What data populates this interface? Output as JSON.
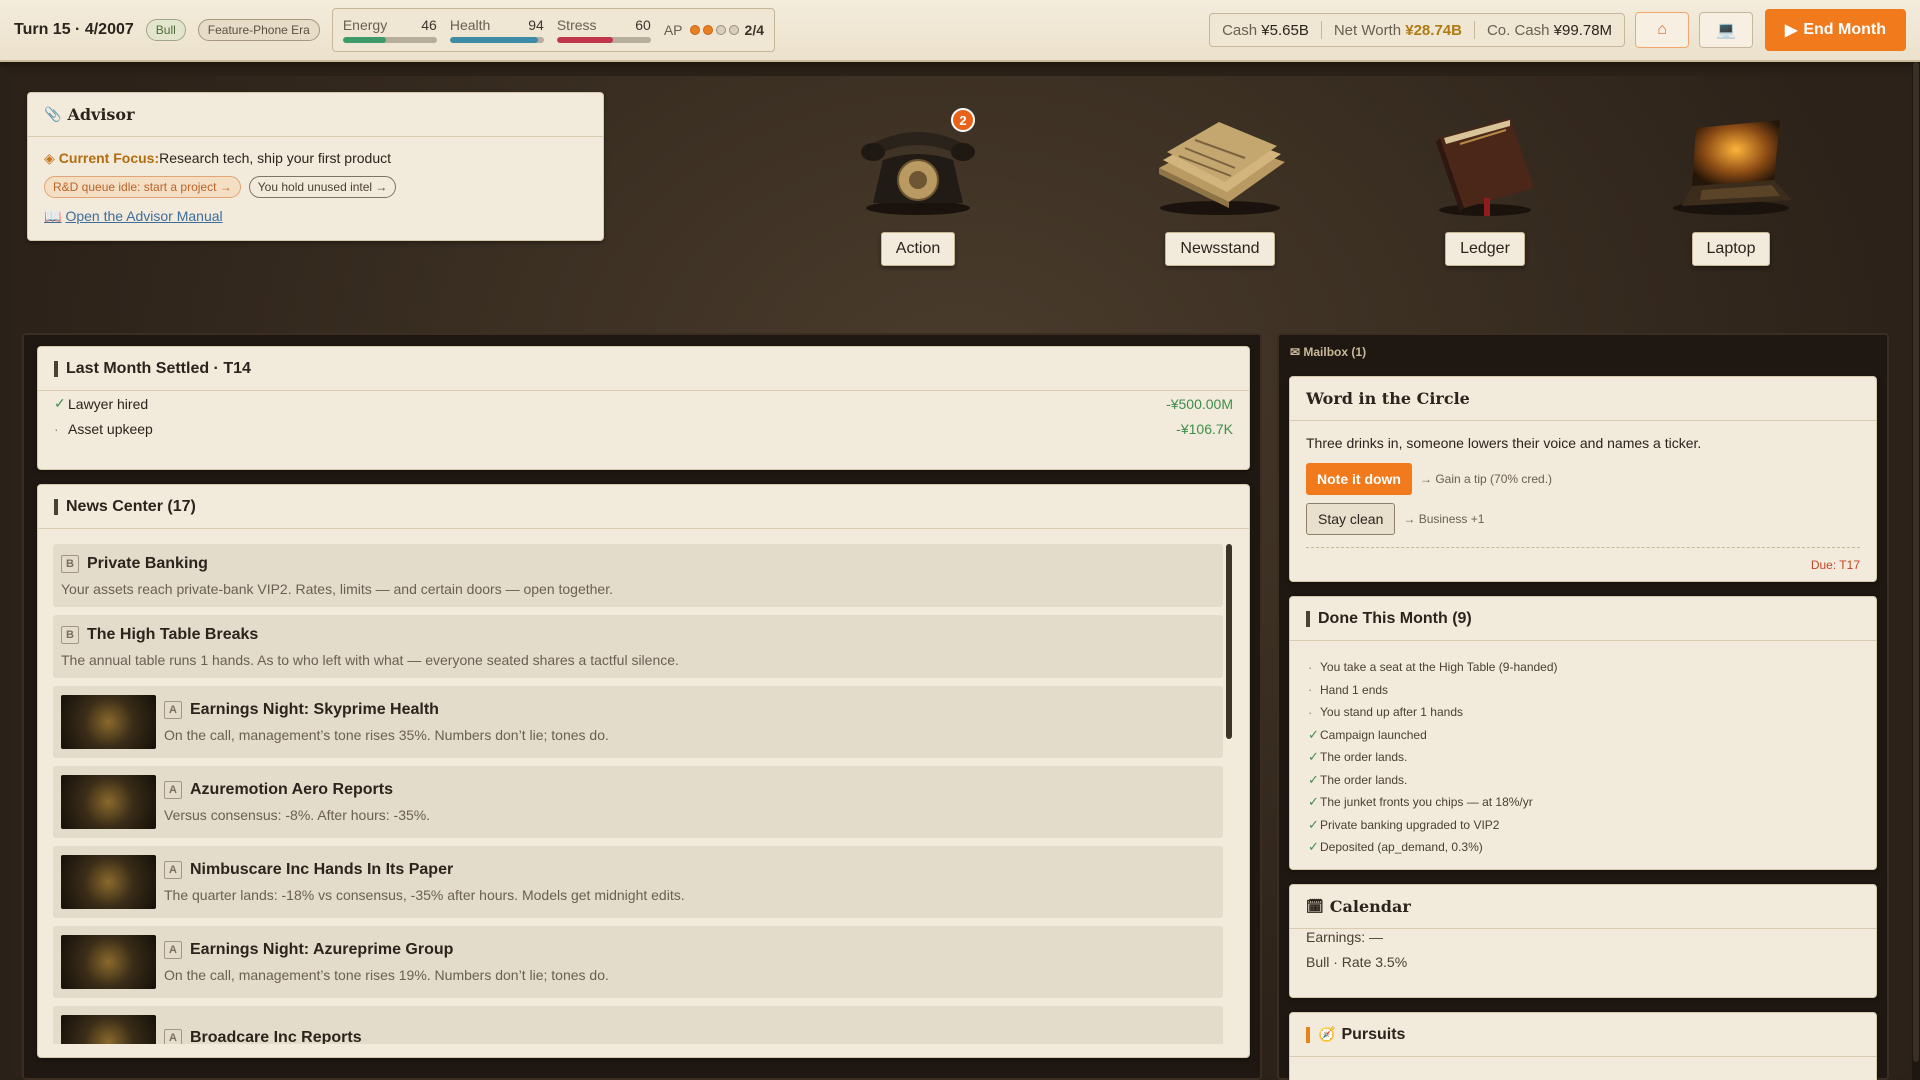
{
  "topbar": {
    "turn": "Turn 15 · 4/2007",
    "market_badge": "Bull",
    "era_badge": "Feature-Phone Era",
    "stats": [
      {
        "label": "Energy",
        "value": "46",
        "level": 0.46,
        "color": "#3f9a6a"
      },
      {
        "label": "Health",
        "value": "94",
        "level": 0.94,
        "color": "#3e8ca8"
      },
      {
        "label": "Stress",
        "value": "60",
        "level": 0.6,
        "color": "#c0364a"
      }
    ],
    "ap_label": "AP",
    "ap_value": "2/4",
    "ap_filled": 2,
    "ap_total": 4,
    "cash_label": "Cash",
    "cash_value": "¥5.65B",
    "networth_label": "Net Worth",
    "networth_value": "¥28.74B",
    "cocash_label": "Co. Cash",
    "cocash_value": "¥99.78M",
    "end_month": "End Month"
  },
  "advisor": {
    "title": "Advisor",
    "focus_label": "Current Focus:",
    "focus_text": "Research tech, ship your first product",
    "chips": [
      "R&D queue idle: start a project →",
      "You hold unused intel →"
    ],
    "manual_link": "Open the Advisor Manual"
  },
  "hotspots": [
    {
      "label": "Action",
      "icon": "telephone-icon",
      "badge": "2"
    },
    {
      "label": "Newsstand",
      "icon": "newspaper-icon"
    },
    {
      "label": "Ledger",
      "icon": "ledger-book-icon"
    },
    {
      "label": "Laptop",
      "icon": "laptop-icon"
    }
  ],
  "settled": {
    "title": "Last Month Settled · T14",
    "rows": [
      {
        "label": "Lawyer hired",
        "amount": "-¥500.00M",
        "done": true
      },
      {
        "label": "Asset upkeep",
        "amount": "-¥106.7K",
        "done": false
      }
    ]
  },
  "news": {
    "title": "News Center (17)",
    "items": [
      {
        "tier": "B",
        "headline": "Private Banking",
        "body": "Your assets reach private-bank VIP2. Rates, limits — and certain doors — open together."
      },
      {
        "tier": "B",
        "headline": "The High Table Breaks",
        "body": "The annual table runs 1 hands. As to who left with what — everyone seated shares a tactful silence."
      },
      {
        "tier": "A",
        "headline": "Earnings Night: Skyprime Health",
        "body": "On the call, management’s tone rises 35%. Numbers don’t lie; tones do."
      },
      {
        "tier": "A",
        "headline": "Azuremotion Aero Reports",
        "body": "Versus consensus: -8%. After hours: -35%."
      },
      {
        "tier": "A",
        "headline": "Nimbuscare Inc Hands In Its Paper",
        "body": "The quarter lands: -18% vs consensus, -35% after hours. Models get midnight edits."
      },
      {
        "tier": "A",
        "headline": "Earnings Night: Azureprime Group",
        "body": "On the call, management’s tone rises 19%. Numbers don’t lie; tones do."
      },
      {
        "tier": "A",
        "headline": "Broadcare Inc Reports",
        "body": ""
      }
    ]
  },
  "mailbox": {
    "header": "Mailbox (1)",
    "title": "Word in the Circle",
    "text": "Three drinks in, someone lowers their voice and names a ticker.",
    "choice1": "Note it down",
    "choice1_effect": "→ Gain a tip (70% cred.)",
    "choice2": "Stay clean",
    "choice2_effect": "→ Business +1",
    "due": "Due: T17"
  },
  "done": {
    "title": "Done This Month (9)",
    "items": [
      {
        "text": "You take a seat at the High Table (9-handed)",
        "check": false
      },
      {
        "text": "Hand 1 ends",
        "check": false
      },
      {
        "text": "You stand up after 1 hands",
        "check": false
      },
      {
        "text": "Campaign launched",
        "check": true
      },
      {
        "text": "The order lands.",
        "check": true
      },
      {
        "text": "The order lands.",
        "check": true
      },
      {
        "text": "The junket fronts you chips — at 18%/yr",
        "check": true
      },
      {
        "text": "Private banking upgraded to VIP2",
        "check": true
      },
      {
        "text": "Deposited (ap_demand, 0.3%)",
        "check": true
      }
    ]
  },
  "calendar": {
    "title": "Calendar",
    "earnings": "Earnings: —",
    "rate": "Bull · Rate 3.5%"
  },
  "pursuits": {
    "title": "Pursuits"
  }
}
